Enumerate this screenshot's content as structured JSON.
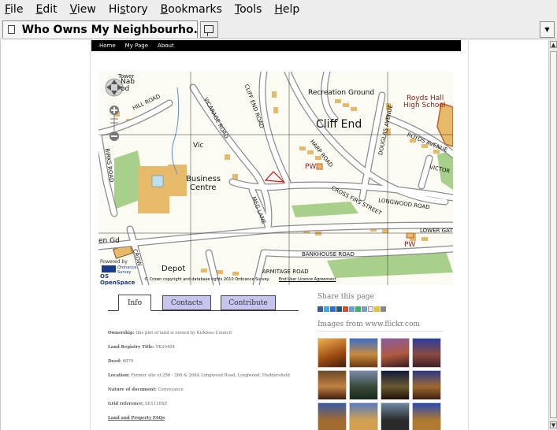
{
  "menubar": {
    "items": [
      {
        "label": "File",
        "accel": "F",
        "rest": "ile"
      },
      {
        "label": "Edit",
        "accel": "E",
        "rest": "dit"
      },
      {
        "label": "View",
        "accel": "V",
        "rest": "iew"
      },
      {
        "label": "History",
        "accel": "s",
        "pre": "Hi",
        "rest": "tory"
      },
      {
        "label": "Bookmarks",
        "accel": "B",
        "rest": "ookmarks"
      },
      {
        "label": "Tools",
        "accel": "T",
        "rest": "ools"
      },
      {
        "label": "Help",
        "accel": "H",
        "rest": "elp"
      }
    ]
  },
  "tab": {
    "title": "Who Owns My Neighbourho..."
  },
  "site_nav": [
    "Home",
    "My Page",
    "About"
  ],
  "map": {
    "labels": {
      "recreation_ground": "Recreation Ground",
      "royds_hall": "Royds Hall",
      "high_school": "High School",
      "cliff_end": "Cliff End",
      "business": "Business",
      "centre": "Centre",
      "vic": "Vic",
      "pw1": "PW",
      "pw2": "PW",
      "depot": "Depot",
      "en_gd": "en Gd",
      "vicarage_road": "VICARAGE ROAD",
      "cliff_end_road": "CLIFF END ROAD",
      "harp_road": "HARP ROAD",
      "douglas_avenue": "DOUGLAS AVENUE",
      "royds_avenue": "ROYDS AVENUE",
      "victoria": "VICTOR",
      "cross_firs_street": "CROSS FIRS STREET",
      "longwood_road": "LONGWOOD ROAD",
      "lower_gate": "LOWER GATE",
      "bankhouse_road": "BANKHOUSE ROAD",
      "armitage_road": "ARMITAGE ROAD",
      "meg_lane": "MEG LANE",
      "hill_road": "HILL ROAD",
      "birks_road": "BIRKS ROAD",
      "crow": "CROW",
      "nab": "Nab",
      "od": "od",
      "tower": "Tower"
    },
    "copyright": "© Crown copyright and database rights 2010 Ordnance Survey.",
    "licence_link": "End User Licence Agreement",
    "os_powered": "Powered by",
    "os_ordnance": "Ordnance Survey",
    "os_openspace": "OS OpenSpace"
  },
  "info_tabs": [
    {
      "label": "Info",
      "active": true
    },
    {
      "label": "Contacts",
      "active": false
    },
    {
      "label": "Contribute",
      "active": false
    }
  ],
  "details": {
    "ownership_label": "Ownership:",
    "ownership_value": "this plot of land is owned by Kirklees Council",
    "land_registry_label": "Land Registry Title:",
    "land_registry_value": "YK20404",
    "deed_label": "Deed:",
    "deed_value": "6879",
    "location_label": "Location:",
    "location_value": "Former site of 256 - 266 & 268A Longwood Road, Longwood, Huddersfield",
    "nature_label": "Nature of document:",
    "nature_value": "Conveyance",
    "grid_label": "Grid reference:",
    "grid_value": "SE1116SE",
    "faq_link": "Land and Property FAQs"
  },
  "share": {
    "heading": "Share this page",
    "icons": [
      "facebook-icon",
      "twitter-icon",
      "delicious-icon",
      "digg-icon",
      "stumbleupon-icon",
      "reddit-icon",
      "google-icon",
      "myspace-icon",
      "email-icon",
      "favorite-icon",
      "print-icon"
    ]
  },
  "flickr": {
    "heading": "Images from www.flickr.com"
  },
  "colors": {
    "map_bg": "#fbfbf3",
    "road_fill": "#ffffff",
    "road_edge": "#8c8c8c",
    "building": "#e7ba6a",
    "grass": "#a8d08a",
    "tab_inactive": "#c5c5ef",
    "landmark": "#c3602d"
  }
}
